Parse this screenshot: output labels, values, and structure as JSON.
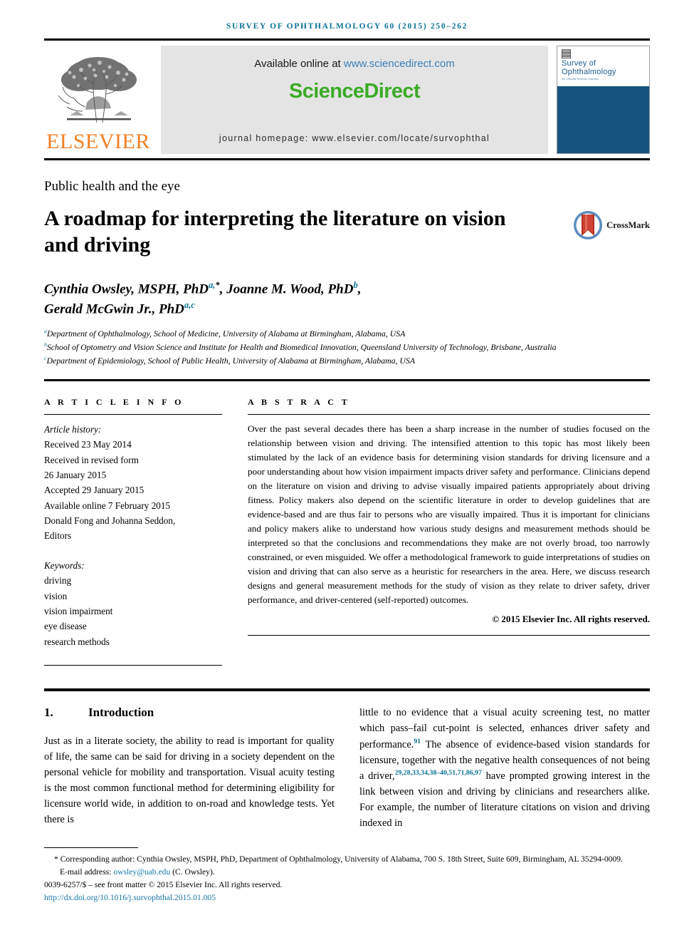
{
  "running_head": "Survey of Ophthalmology 60 (2015) 250–262",
  "masthead": {
    "elsevier_wordmark": "ELSEVIER",
    "available_prefix": "Available online at ",
    "available_link": "www.sciencedirect.com",
    "sciencedirect_logo": "ScienceDirect",
    "journal_homepage": "journal homepage: www.elsevier.com/locate/survophthal",
    "cover_title_line1": "Survey of",
    "cover_title_line2": "Ophthalmology",
    "cover_subtitle": "An Official Review Journal",
    "cover_color": "#16537e",
    "sciencedirect_color": "#3caa28",
    "elsevier_color": "#f18024",
    "link_color": "#3f7fb5"
  },
  "kicker": "Public health and the eye",
  "title": "A roadmap for interpreting the literature on vision and driving",
  "crossmark": {
    "label": "CrossMark"
  },
  "authors_line1_a": "Cynthia Owsley, MSPH, PhD",
  "authors_sup1": "a,",
  "authors_star": "*",
  "authors_line1_b": ", Joanne M. Wood, PhD",
  "authors_sup2": "b",
  "authors_line1_c": ",",
  "authors_line2_a": "Gerald McGwin Jr., PhD",
  "authors_sup3": "a,c",
  "affiliations": [
    {
      "marker": "a",
      "text": "Department of Ophthalmology, School of Medicine, University of Alabama at Birmingham, Alabama, USA"
    },
    {
      "marker": "b",
      "text": "School of Optometry and Vision Science and Institute for Health and Biomedical Innovation, Queensland University of Technology, Brisbane, Australia"
    },
    {
      "marker": "c",
      "text": "Department of Epidemiology, School of Public Health, University of Alabama at Birmingham, Alabama, USA"
    }
  ],
  "article_info": {
    "heading": "A R T I C L E   I N F O",
    "history_label": "Article history:",
    "history": [
      "Received 23 May 2014",
      "Received in revised form",
      "26 January 2015",
      "Accepted 29 January 2015",
      "Available online 7 February 2015",
      "Donald Fong and Johanna Seddon,",
      "Editors"
    ],
    "keywords_label": "Keywords:",
    "keywords": [
      "driving",
      "vision",
      "vision impairment",
      "eye disease",
      "research methods"
    ]
  },
  "abstract": {
    "heading": "A B S T R A C T",
    "text": "Over the past several decades there has been a sharp increase in the number of studies focused on the relationship between vision and driving. The intensified attention to this topic has most likely been stimulated by the lack of an evidence basis for determining vision standards for driving licensure and a poor understanding about how vision impairment impacts driver safety and performance. Clinicians depend on the literature on vision and driving to advise visually impaired patients appropriately about driving fitness. Policy makers also depend on the scientific literature in order to develop guidelines that are evidence-based and are thus fair to persons who are visually impaired. Thus it is important for clinicians and policy makers alike to understand how various study designs and measurement methods should be interpreted so that the conclusions and recommendations they make are not overly broad, too narrowly constrained, or even misguided. We offer a methodological framework to guide interpretations of studies on vision and driving that can also serve as a heuristic for researchers in the area. Here, we discuss research designs and general measurement methods for the study of vision as they relate to driver safety, driver performance, and driver-centered (self-reported) outcomes.",
    "copyright": "© 2015 Elsevier Inc. All rights reserved."
  },
  "section": {
    "number": "1.",
    "title": "Introduction"
  },
  "body": {
    "left_para": "Just as in a literate society, the ability to read is important for quality of life, the same can be said for driving in a society dependent on the personal vehicle for mobility and transportation. Visual acuity testing is the most common functional method for determining eligibility for licensure world wide, in addition to on-road and knowledge tests. Yet there is",
    "right_part1": "little to no evidence that a visual acuity screening test, no matter which pass–fail cut-point is selected, enhances driver safety and performance.",
    "right_cite1": "91",
    "right_part2": " The absence of evidence-based vision standards for licensure, together with the negative health consequences of not being a driver,",
    "right_cite2": "29,28,33,34,38–40,51,71,86,97",
    "right_part3": " have prompted growing interest in the link between vision and driving by clinicians and researchers alike. For example, the number of literature citations on vision and driving indexed in"
  },
  "footnotes": {
    "corresponding": "Corresponding author: Cynthia Owsley, MSPH, PhD, Department of Ophthalmology, University of Alabama, 700 S. 18th Street, Suite 609, Birmingham, AL 35294-0009.",
    "email_label": "E-mail address: ",
    "email": "owsley@uab.edu",
    "email_suffix": " (C. Owsley).",
    "issn_line": "0039-6257/$ – see front matter  © 2015 Elsevier Inc. All rights reserved.",
    "doi": "http://dx.doi.org/10.1016/j.survophthal.2015.01.005",
    "link_color": "#1676a8"
  }
}
